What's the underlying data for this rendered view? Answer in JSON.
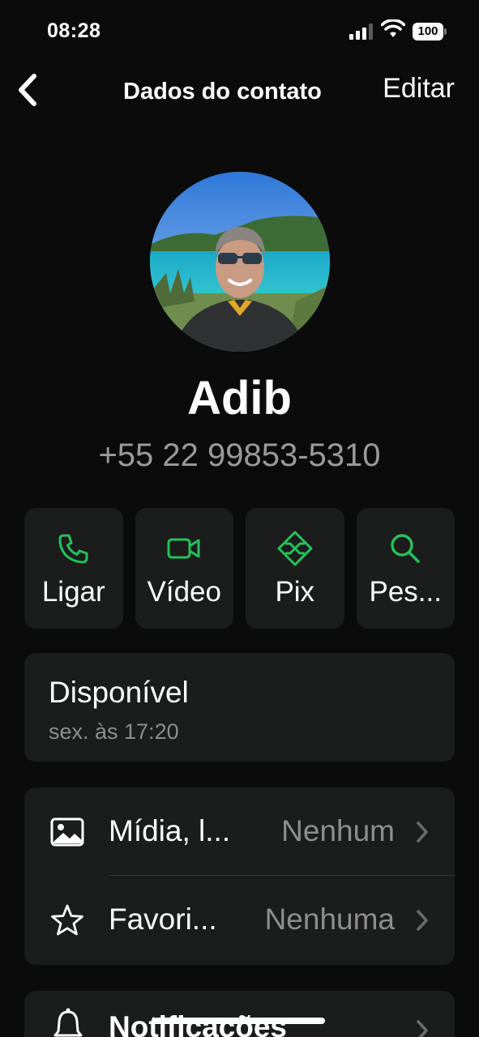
{
  "status_bar": {
    "time": "08:28",
    "battery": "100"
  },
  "nav": {
    "title": "Dados do contato",
    "edit_label": "Editar"
  },
  "contact": {
    "name": "Adib",
    "phone": "+55 22 99853-5310"
  },
  "actions": [
    {
      "label": "Ligar",
      "icon": "phone-icon"
    },
    {
      "label": "Vídeo",
      "icon": "video-icon"
    },
    {
      "label": "Pix",
      "icon": "pix-icon"
    },
    {
      "label": "Pes...",
      "icon": "search-icon"
    }
  ],
  "about": {
    "status": "Disponível",
    "updated": "sex. às 17:20"
  },
  "list": [
    {
      "label": "Mídia, l...",
      "value": "Nenhum",
      "icon": "image-icon"
    },
    {
      "label": "Favori...",
      "value": "Nenhuma",
      "icon": "star-icon"
    }
  ],
  "list2": [
    {
      "label": "Notificações",
      "icon": "bell-icon"
    }
  ],
  "colors": {
    "accent": "#27c15b",
    "background": "#0b0b0b",
    "card": "#1b1c1c",
    "secondary_text": "#8e8e8e"
  }
}
